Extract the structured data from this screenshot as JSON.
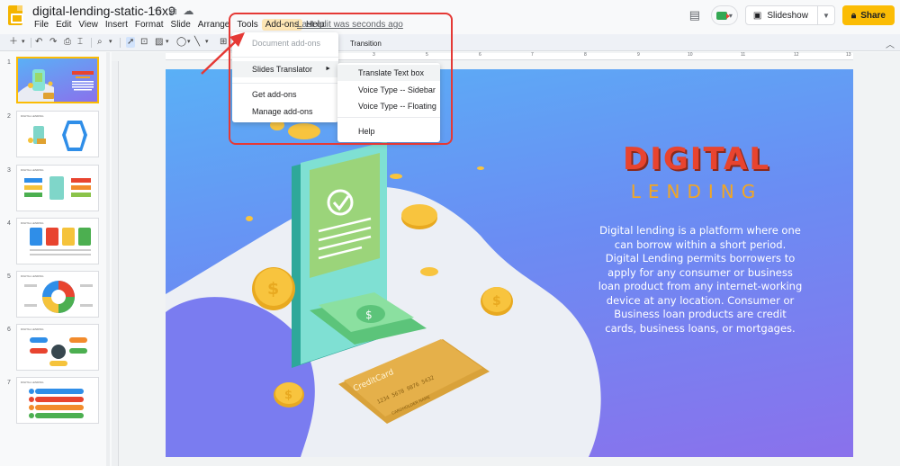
{
  "doc": {
    "title": "digital-lending-static-16x9",
    "last_edit": "Last edit was seconds ago"
  },
  "menubar": {
    "items": [
      "File",
      "Edit",
      "View",
      "Insert",
      "Format",
      "Slide",
      "Arrange",
      "Tools",
      "Add-ons",
      "Help"
    ],
    "active": "Add-ons"
  },
  "header_right": {
    "slideshow_label": "Slideshow",
    "share_label": "Share"
  },
  "toolbar": {
    "transition_label": "Transition"
  },
  "addons_menu": {
    "items": [
      {
        "label": "Document add-ons",
        "disabled": true
      },
      {
        "label": "Slides Translator",
        "has_submenu": true,
        "highlighted": true
      },
      {
        "label": "Get add-ons"
      },
      {
        "label": "Manage add-ons"
      }
    ]
  },
  "submenu": {
    "items": [
      {
        "label": "Translate Text box",
        "highlighted": true
      },
      {
        "label": "Voice Type -- Sidebar"
      },
      {
        "label": "Voice Type -- Floating"
      },
      {
        "label": "Help"
      }
    ]
  },
  "filmstrip": {
    "slides": [
      "1",
      "2",
      "3",
      "4",
      "5",
      "6",
      "7"
    ],
    "selected": "1",
    "thumb_title": "DIGITAL LENDING"
  },
  "ruler": {
    "ticks": [
      "1",
      "2",
      "3",
      "4",
      "5",
      "6",
      "7",
      "8",
      "9",
      "10",
      "11",
      "12",
      "13"
    ]
  },
  "slide": {
    "title": "DIGITAL",
    "subtitle": "LENDING",
    "description": "Digital lending is a platform where one can borrow within a short period. Digital Lending permits borrowers to apply for any consumer or business loan product from any internet-working device at any location. Consumer or Business loan products are credit cards, business loans, or mortgages.",
    "card_brand": "CreditCard",
    "card_number": "1234 5678 9876 5432",
    "card_holder": "CARDHOLDER NAME",
    "coin_symbol": "$"
  },
  "colors": {
    "title_red": "#e8442f",
    "subtitle_orange": "#f2a623",
    "share_yellow": "#fbbc04",
    "highlight_red": "#e53935"
  }
}
